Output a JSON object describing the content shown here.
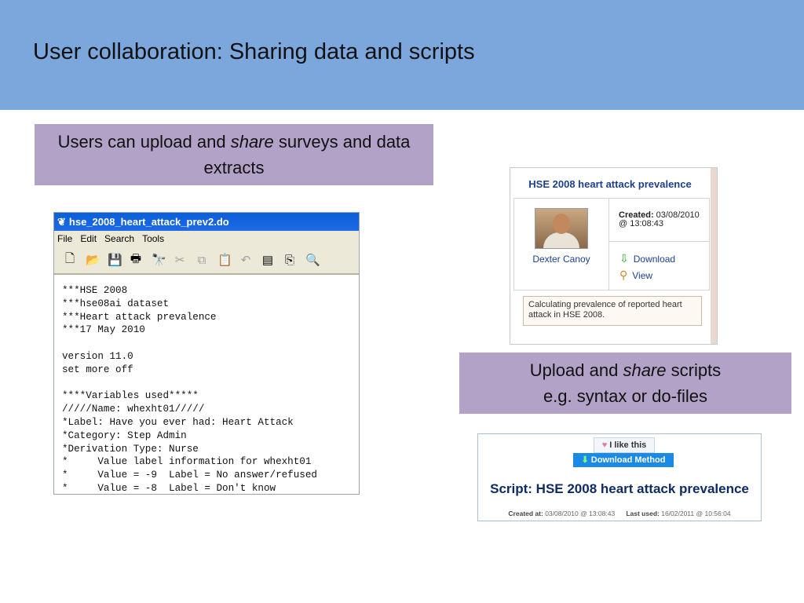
{
  "slide": {
    "title": "User collaboration: Sharing data and scripts",
    "callout1": {
      "pre": "Users can upload and ",
      "em": "share",
      "post": " surveys and data extracts"
    },
    "callout2": {
      "line1_pre": "Upload and ",
      "line1_em": "share",
      "line1_post": " scripts",
      "line2": "e.g. syntax or do-files"
    }
  },
  "editor": {
    "title": "hse_2008_heart_attack_prev2.do",
    "menu": [
      "File",
      "Edit",
      "Search",
      "Tools"
    ],
    "toolbar_icons": [
      "new-file-icon",
      "open-folder-icon",
      "save-icon",
      "print-icon",
      "find-icon",
      "cut-icon",
      "copy-icon",
      "paste-icon",
      "undo-icon",
      "do-file-icon",
      "run-icon",
      "preview-icon"
    ],
    "code": "***HSE 2008\n***hse08ai dataset\n***Heart attack prevalence\n***17 May 2010\n\nversion 11.0\nset more off\n\n****Variables used*****\n/////Name: whexht01/////\n*Label: Have you ever had: Heart Attack\n*Category: Step Admin\n*Derivation Type: Nurse\n*     Value label information for whexht01\n*     Value = -9  Label = No answer/refused\n*     Value = -8  Label = Don't know"
  },
  "dataset_card": {
    "title": "HSE 2008 heart attack prevalence",
    "author": "Dexter Canoy",
    "created_label": "Created:",
    "created_date": " 03/08/2010",
    "created_time": "@ 13:08:43",
    "download_label": "Download",
    "view_label": "View",
    "description": "Calculating prevalence of reported heart attack in HSE 2008."
  },
  "script_card": {
    "like_label": "I like this",
    "download_label": "Download Method",
    "title": "Script: HSE 2008 heart attack prevalence",
    "created_label": "Created at:",
    "created_value": " 03/08/2010 @ 13:08:43",
    "last_used_label": "Last used:",
    "last_used_value": " 16/02/2011 @ 10:56:04"
  },
  "colors": {
    "header_bg": "#7ba7dc",
    "callout_bg": "#b3a2c7",
    "link": "#1d3f8c",
    "download_button": "#1a8ae6"
  }
}
